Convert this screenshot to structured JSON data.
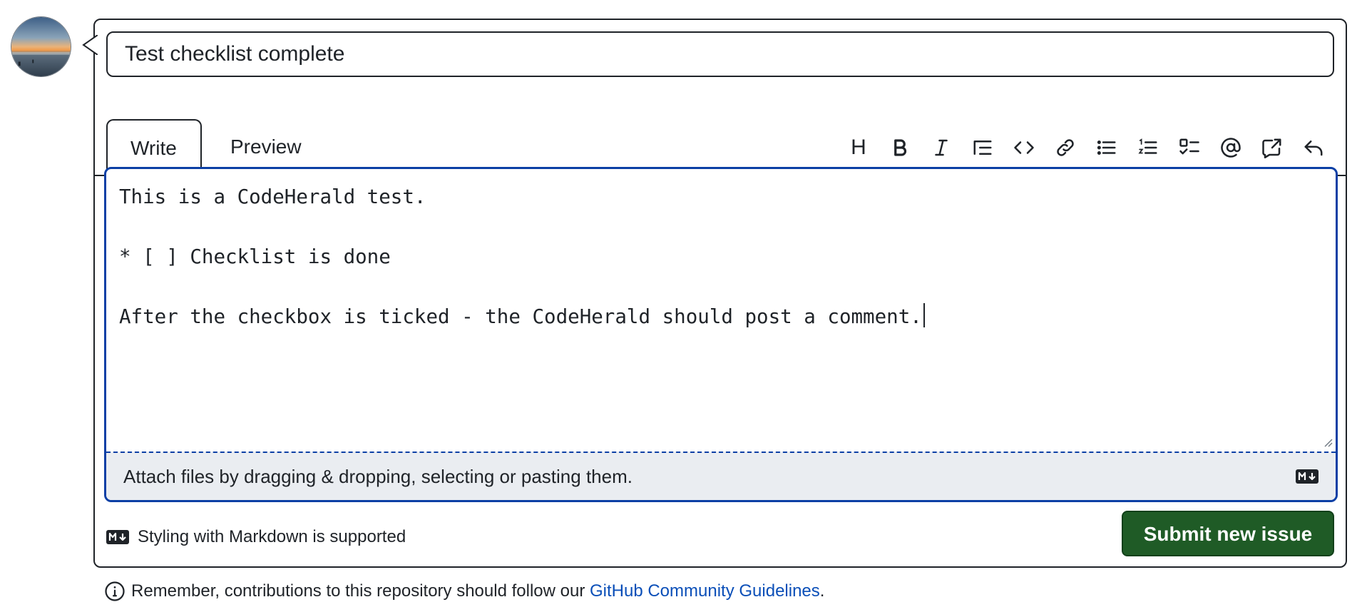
{
  "issue": {
    "title_value": "Test checklist complete"
  },
  "tabs": [
    {
      "label": "Write",
      "selected": true
    },
    {
      "label": "Preview",
      "selected": false
    }
  ],
  "toolbar": {
    "icons": [
      "heading-icon",
      "bold-icon",
      "italic-icon",
      "quote-icon",
      "code-icon",
      "link-icon",
      "unordered-list-icon",
      "ordered-list-icon",
      "task-list-icon",
      "mention-icon",
      "reference-icon",
      "undo-icon"
    ],
    "heading_glyph": "H"
  },
  "editor": {
    "lines": [
      "This is a CodeHerald test.",
      "",
      "* [ ] Checklist is done",
      "",
      "After the checkbox is ticked - the CodeHerald should post a comment."
    ],
    "attach_hint": "Attach files by dragging & dropping, selecting or pasting them."
  },
  "markdown_note": "Styling with Markdown is supported",
  "submit_label": "Submit new issue",
  "footer": {
    "text": "Remember, contributions to this repository should follow our ",
    "link_text": "GitHub Community Guidelines",
    "end": "."
  },
  "colors": {
    "submit_bg": "#1f5b26",
    "focus_border": "#0b3fa5",
    "link": "#0b4fb8"
  }
}
